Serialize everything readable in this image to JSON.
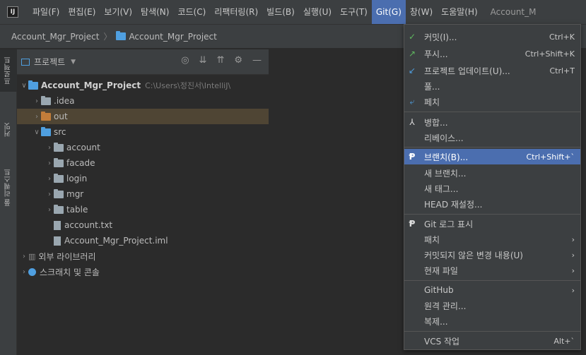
{
  "menubar": {
    "items": [
      "파일(F)",
      "편집(E)",
      "보기(V)",
      "탐색(N)",
      "코드(C)",
      "리팩터링(R)",
      "빌드(B)",
      "실행(U)",
      "도구(T)",
      "Git(G)",
      "창(W)",
      "도움말(H)"
    ],
    "window_title": "Account_M"
  },
  "breadcrumb": {
    "root": "Account_Mgr_Project",
    "module": "Account_Mgr_Project"
  },
  "side_tabs": {
    "project": "프로젝트",
    "commit": "커밋",
    "pull_requests": "풀 리퀘스트"
  },
  "panel": {
    "title": "프로젝트"
  },
  "tree": {
    "root_name": "Account_Mgr_Project",
    "root_path": "C:\\Users\\정진서\\IntelliJ\\",
    "idea": ".idea",
    "out": "out",
    "src": "src",
    "account": "account",
    "facade": "facade",
    "login": "login",
    "mgr": "mgr",
    "table": "table",
    "account_txt": "account.txt",
    "iml": "Account_Mgr_Project.iml",
    "ext_libs": "외부 라이브러리",
    "scratches": "스크래치 및 콘솔"
  },
  "git_menu": {
    "commit": "커밋(I)...",
    "commit_sc": "Ctrl+K",
    "push": "푸시...",
    "push_sc": "Ctrl+Shift+K",
    "update": "프로젝트 업데이트(U)...",
    "update_sc": "Ctrl+T",
    "pull": "풀...",
    "fetch": "페치",
    "merge": "병합...",
    "rebase": "리베이스...",
    "branch": "브랜치(B)...",
    "branch_sc": "Ctrl+Shift+`",
    "new_branch": "새 브랜치...",
    "new_tag": "새 태그...",
    "head_reset": "HEAD 재설정...",
    "show_log": "Git 로그 표시",
    "patch": "패치",
    "uncommitted": "커밋되지 않은 변경 내용(U)",
    "current_file": "현재 파일",
    "github": "GitHub",
    "remotes": "원격 관리...",
    "clone": "복제...",
    "vcs_ops": "VCS 작업",
    "vcs_sc": "Alt+`"
  },
  "colors": {
    "accent": "#4b6eaf",
    "selection_row": "#4f4534",
    "background": "#2b2b2b"
  }
}
